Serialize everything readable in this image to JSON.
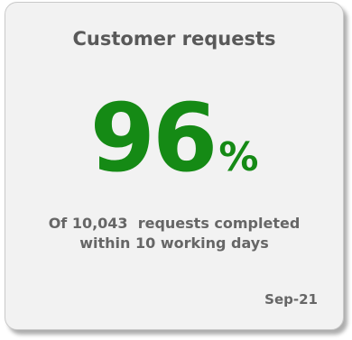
{
  "card": {
    "title": "Customer requests",
    "metric": {
      "value": "96",
      "unit": "%"
    },
    "description": {
      "line1": "Of 10,043  requests completed",
      "line2": "within 10 working days"
    },
    "period": "Sep-21"
  },
  "colors": {
    "metric": "#158a15",
    "text": "#666666",
    "title": "#595959",
    "card_background": "#f2f2f2"
  }
}
